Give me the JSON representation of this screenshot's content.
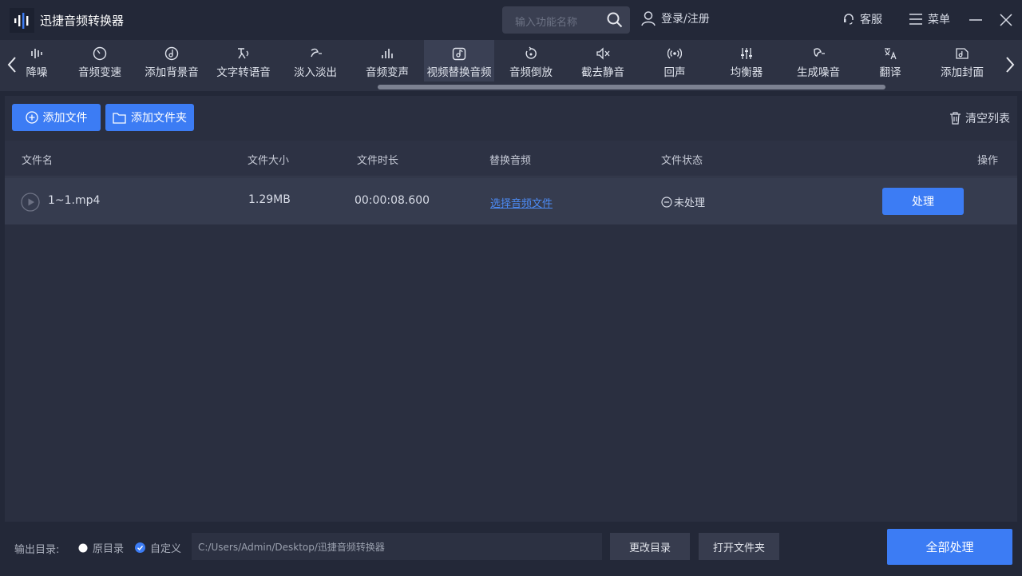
{
  "app": {
    "title": "迅捷音频转换器"
  },
  "search": {
    "placeholder": "输入功能名称"
  },
  "titlebar": {
    "login": "登录/注册",
    "service": "客服",
    "menu": "菜单"
  },
  "tools": [
    {
      "label": "降噪",
      "icon": "noise-reduce-icon"
    },
    {
      "label": "音频变速",
      "icon": "speed-icon"
    },
    {
      "label": "添加背景音",
      "icon": "background-music-icon"
    },
    {
      "label": "文字转语音",
      "icon": "text-to-speech-icon"
    },
    {
      "label": "淡入淡出",
      "icon": "fade-icon"
    },
    {
      "label": "音频变声",
      "icon": "voice-change-icon"
    },
    {
      "label": "视频替换音频",
      "icon": "video-replace-audio-icon",
      "active": true
    },
    {
      "label": "音频倒放",
      "icon": "reverse-icon"
    },
    {
      "label": "截去静音",
      "icon": "mute-cut-icon"
    },
    {
      "label": "回声",
      "icon": "echo-icon"
    },
    {
      "label": "均衡器",
      "icon": "equalizer-icon"
    },
    {
      "label": "生成噪音",
      "icon": "noise-generate-icon"
    },
    {
      "label": "翻译",
      "icon": "translate-icon"
    },
    {
      "label": "添加封面",
      "icon": "cover-icon"
    }
  ],
  "toolbar": {
    "add_file": "添加文件",
    "add_folder": "添加文件夹",
    "clear_list": "清空列表"
  },
  "table": {
    "headers": {
      "name": "文件名",
      "size": "文件大小",
      "duration": "文件时长",
      "replace": "替换音频",
      "status": "文件状态",
      "action": "操作"
    },
    "rows": [
      {
        "name": "1~1.mp4",
        "size": "1.29MB",
        "duration": "00:00:08.600",
        "replace": "选择音频文件",
        "status": "未处理",
        "action": "处理"
      }
    ]
  },
  "footer": {
    "output_label": "输出目录:",
    "option_original": "原目录",
    "option_custom": "自定义",
    "path": "C:/Users/Admin/Desktop/迅捷音频转换器",
    "change_dir": "更改目录",
    "open_folder": "打开文件夹",
    "process_all": "全部处理"
  },
  "colors": {
    "accent": "#3c7cf4",
    "background": "#232838",
    "panel": "#2a2f40"
  }
}
